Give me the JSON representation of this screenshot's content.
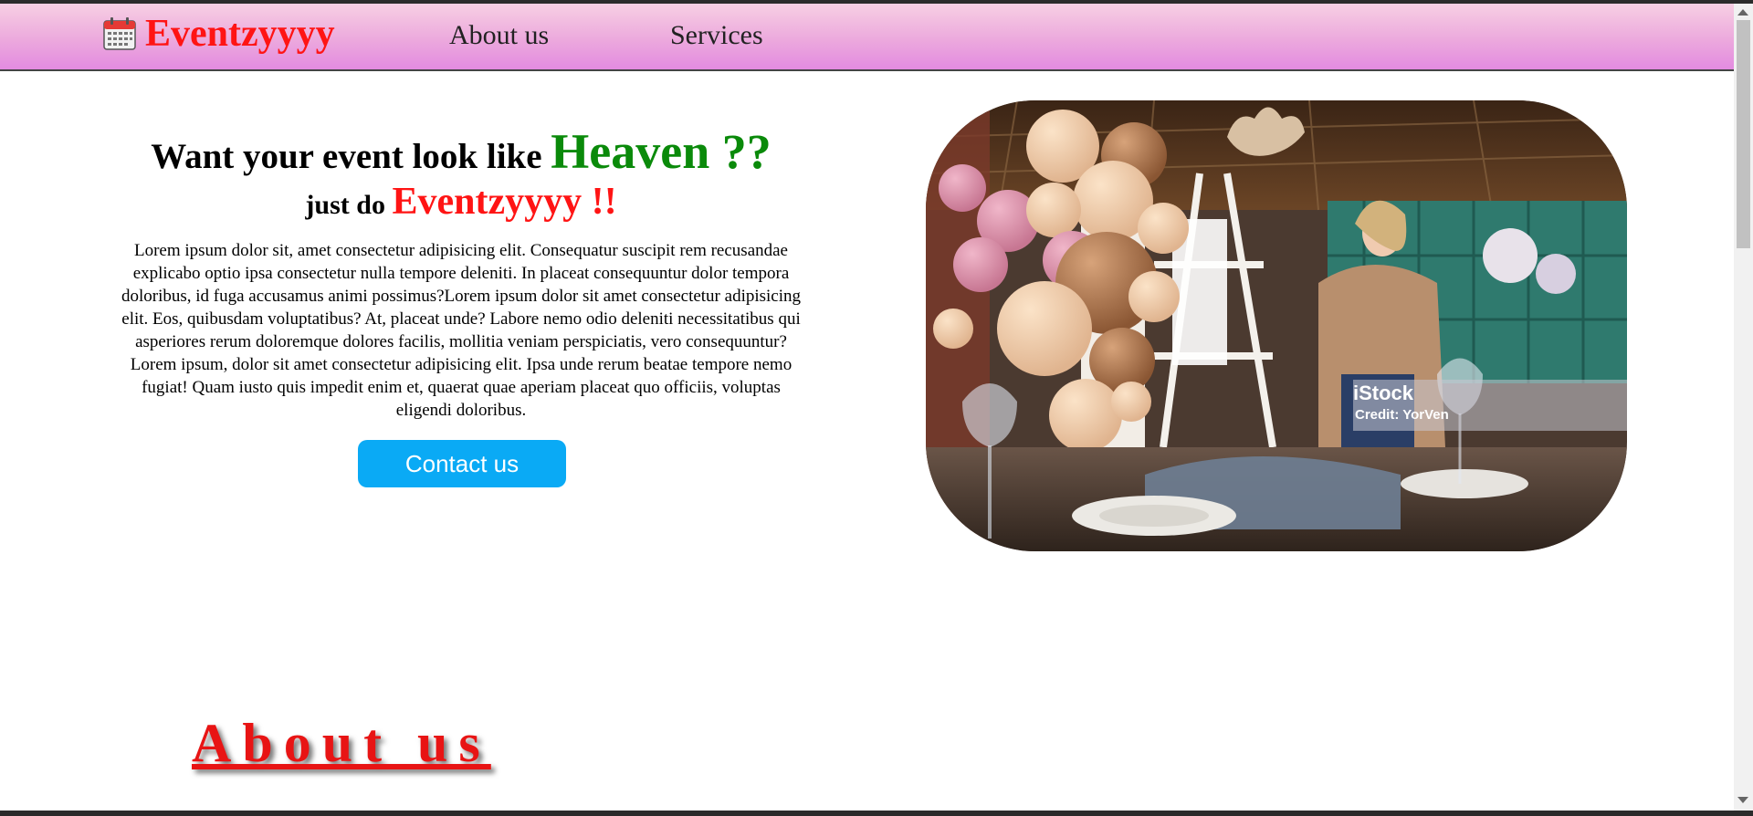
{
  "navbar": {
    "logo_icon": "calendar-icon",
    "brand": "Eventzyyyy",
    "links": [
      "About us",
      "Services"
    ]
  },
  "hero": {
    "heading_prefix": "Want your event look like ",
    "heading_accent": "Heaven ??",
    "sub_prefix": "just do ",
    "sub_accent": "Eventzyyyy !!",
    "body": "Lorem ipsum dolor sit, amet consectetur adipisicing elit. Consequatur suscipit rem recusandae explicabo optio ipsa consectetur nulla tempore deleniti. In placeat consequuntur dolor tempora doloribus, id fuga accusamus animi possimus?Lorem ipsum dolor sit amet consectetur adipisicing elit. Eos, quibusdam voluptatibus? At, placeat unde? Labore nemo odio deleniti necessitatibus qui asperiores rerum doloremque dolores facilis, mollitia veniam perspiciatis, vero consequuntur?Lorem ipsum, dolor sit amet consectetur adipisicing elit. Ipsa unde rerum beatae tempore nemo fugiat! Quam iusto quis impedit enim et, quaerat quae aperiam placeat quo officiis, voluptas eligendi doloribus.",
    "contact_button": "Contact us",
    "image": {
      "watermark_logo": "iStock",
      "watermark_credit": "Credit: YorVen"
    }
  },
  "about": {
    "heading": "About us"
  },
  "colors": {
    "brand_red": "#ff1414",
    "accent_green": "#0a8a0a",
    "button_blue": "#0aaaf5",
    "nav_gradient_top": "#f7cfe3",
    "nav_gradient_bottom": "#e38be0"
  }
}
